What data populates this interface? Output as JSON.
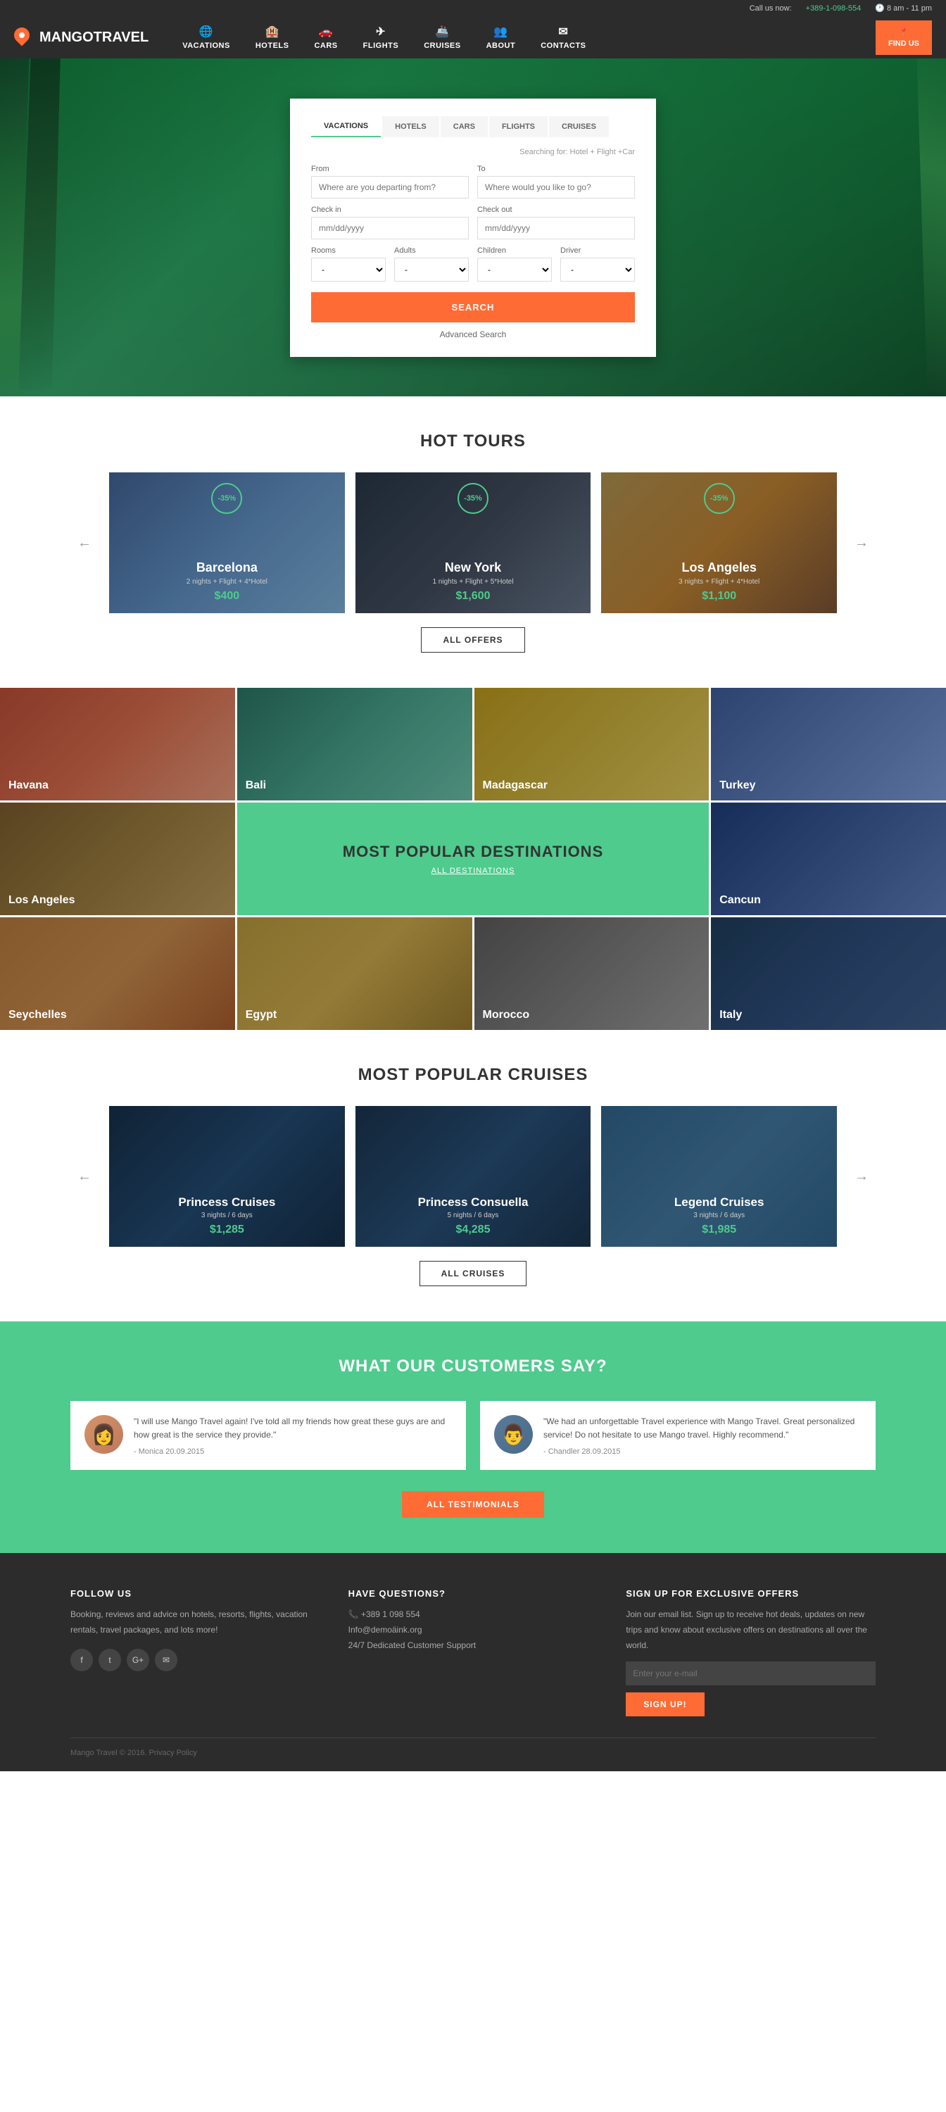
{
  "topbar": {
    "call_label": "Call us now:",
    "phone": "+389-1-098-554",
    "hours": "8 am - 11 pm"
  },
  "nav": {
    "logo": "MANGOTRAVEL",
    "items": [
      {
        "label": "VACATIONS",
        "icon": "🌐"
      },
      {
        "label": "HOTELS",
        "icon": "🏨"
      },
      {
        "label": "CARS",
        "icon": "🚗"
      },
      {
        "label": "FLIGHTS",
        "icon": "✈"
      },
      {
        "label": "CRUISES",
        "icon": "🚢"
      },
      {
        "label": "ABOUT",
        "icon": "👥"
      },
      {
        "label": "CONTACTS",
        "icon": "✉"
      }
    ],
    "find_us": "FIND US"
  },
  "search": {
    "tabs": [
      "VACATIONS",
      "HOTELS",
      "CARS",
      "FLIGHTS",
      "CRUISES"
    ],
    "active_tab": "VACATIONS",
    "subtext": "Searching for: Hotel + Flight +Car",
    "from_label": "From",
    "from_placeholder": "Where are you departing from?",
    "to_label": "To",
    "to_placeholder": "Where would you like to go?",
    "checkin_label": "Check in",
    "checkin_placeholder": "mm/dd/yyyy",
    "checkout_label": "Check out",
    "checkout_placeholder": "mm/dd/yyyy",
    "rooms_label": "Rooms",
    "adults_label": "Adults",
    "children_label": "Children",
    "driver_label": "Driver",
    "search_btn": "SEARCH",
    "advanced_label": "Advanced Search"
  },
  "hot_tours": {
    "title": "HOT TOURS",
    "cards": [
      {
        "city": "Barcelona",
        "desc": "2 nights + Flight + 4*Hotel",
        "price": "$400",
        "discount": "-35%"
      },
      {
        "city": "New York",
        "desc": "1 nights + Flight + 5*Hotel",
        "price": "$1,600",
        "discount": "-35%"
      },
      {
        "city": "Los Angeles",
        "desc": "3 nights + Flight + 4*Hotel",
        "price": "$1,100",
        "discount": "-35%"
      }
    ],
    "all_offers_btn": "ALL OFFERS"
  },
  "destinations": {
    "title": "MOST POPULAR DESTINATIONS",
    "link": "ALL DESTINATIONS",
    "cells": [
      "Havana",
      "Bali",
      "Madagascar",
      "Turkey",
      "Los Angeles",
      "MOST POPULAR DESTINATIONS",
      "Cancun",
      "Seychelles",
      "Egypt",
      "Morocco",
      "Italy"
    ]
  },
  "cruises": {
    "title": "MOST POPULAR CRUISES",
    "cards": [
      {
        "name": "Princess Cruises",
        "desc": "3 nights / 6 days",
        "price": "$1,285"
      },
      {
        "name": "Princess Consuella",
        "desc": "5 nights / 6 days",
        "price": "$4,285"
      },
      {
        "name": "Legend Cruises",
        "desc": "3 nights / 6 days",
        "price": "$1,985"
      }
    ],
    "all_cruises_btn": "ALL CRUISES"
  },
  "testimonials": {
    "title": "WHAT OUR CUSTOMERS SAY?",
    "items": [
      {
        "text": "\"I will use Mango Travel again! I've told all my friends how great these guys are and how great is the service they provide.\"",
        "author": "- Monica  20.09.2015",
        "avatar_type": "female"
      },
      {
        "text": "\"We had an unforgettable Travel experience with Mango Travel. Great personalized service! Do not hesitate to use Mango travel. Highly recommend.\"",
        "author": "- Chandler  28.09.2015",
        "avatar_type": "male"
      }
    ],
    "all_btn": "ALL TESTIMONIALS"
  },
  "footer": {
    "follow_title": "FOLLOW US",
    "follow_text": "Booking, reviews and advice on hotels, resorts, flights, vacation rentals, travel packages, and lots more!",
    "social": [
      "f",
      "t",
      "G+",
      "✉"
    ],
    "questions_title": "HAVE QUESTIONS?",
    "questions_phone": "+389 1 098 554",
    "questions_email": "Info@demoäink.org",
    "questions_support": "24/7 Dedicated Customer Support",
    "signup_title": "SIGN UP FOR EXCLUSIVE OFFERS",
    "signup_text": "Join our email list. Sign up to receive hot deals, updates on new trips and know about exclusive offers on destinations all over the world.",
    "email_placeholder": "Enter your e-mail",
    "signup_btn": "SIGN UP!",
    "copyright": "Mango Travel © 2016. Privacy Policy"
  }
}
